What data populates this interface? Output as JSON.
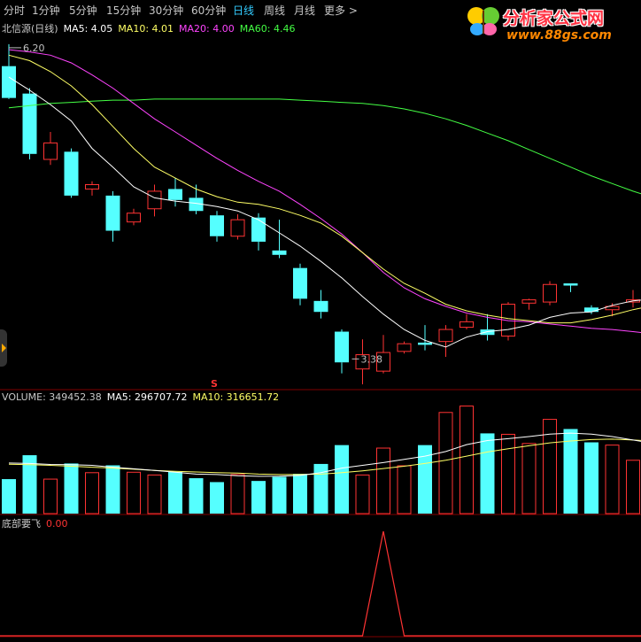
{
  "tabs": [
    {
      "label": "分时"
    },
    {
      "label": "1分钟"
    },
    {
      "label": "5分钟"
    },
    {
      "label": "15分钟"
    },
    {
      "label": "30分钟"
    },
    {
      "label": "60分钟"
    },
    {
      "label": "日线",
      "active": true
    },
    {
      "label": "周线"
    },
    {
      "label": "月线"
    },
    {
      "label": "更多 >"
    }
  ],
  "logo": {
    "title": "分析家公式网",
    "url": "www.88gs.com"
  },
  "price_legend": {
    "name": "北信源(日线)",
    "ma5": "MA5: 4.05",
    "ma10": "MA10: 4.01",
    "ma20": "MA20: 4.00",
    "ma60": "MA60: 4.46"
  },
  "volume_legend": {
    "vol": "VOLUME: 349452.38",
    "ma5": "MA5: 296707.72",
    "ma10": "MA10: 316651.72"
  },
  "indicator_legend": {
    "name": "底部要飞",
    "value": "0.00"
  },
  "signal_marker": "S",
  "high_label": "6.20",
  "low_label": "3.38",
  "colors": {
    "up": "#ff3333",
    "down": "#55ffff",
    "ma5": "#ffffff",
    "ma10": "#ffff66",
    "ma20": "#ff44ff",
    "ma60": "#44ff44",
    "grid": "#800000"
  },
  "chart_data": [
    {
      "type": "candlestick",
      "title": "北信源(日线)",
      "ohlc": [
        [
          6.0,
          6.2,
          5.7,
          5.71
        ],
        [
          5.75,
          5.8,
          5.15,
          5.2
        ],
        [
          5.15,
          5.4,
          5.1,
          5.3
        ],
        [
          5.22,
          5.25,
          4.8,
          4.82
        ],
        [
          4.88,
          4.95,
          4.82,
          4.92
        ],
        [
          4.82,
          4.86,
          4.4,
          4.5
        ],
        [
          4.58,
          4.7,
          4.55,
          4.66
        ],
        [
          4.7,
          4.92,
          4.63,
          4.86
        ],
        [
          4.88,
          4.98,
          4.72,
          4.78
        ],
        [
          4.8,
          4.92,
          4.65,
          4.68
        ],
        [
          4.64,
          4.68,
          4.4,
          4.45
        ],
        [
          4.45,
          4.65,
          4.42,
          4.6
        ],
        [
          4.62,
          4.66,
          4.32,
          4.4
        ],
        [
          4.32,
          4.6,
          4.25,
          4.28
        ],
        [
          4.16,
          4.2,
          3.82,
          3.88
        ],
        [
          3.86,
          3.96,
          3.7,
          3.76
        ],
        [
          3.58,
          3.6,
          3.2,
          3.3
        ],
        [
          3.24,
          3.51,
          3.1,
          3.37
        ],
        [
          3.22,
          3.55,
          3.2,
          3.39
        ],
        [
          3.4,
          3.49,
          3.38,
          3.47
        ],
        [
          3.48,
          3.64,
          3.41,
          3.46
        ],
        [
          3.49,
          3.64,
          3.35,
          3.6
        ],
        [
          3.62,
          3.74,
          3.6,
          3.67
        ],
        [
          3.6,
          3.74,
          3.5,
          3.55
        ],
        [
          3.54,
          3.85,
          3.5,
          3.83
        ],
        [
          3.84,
          3.88,
          3.78,
          3.87
        ],
        [
          3.85,
          4.04,
          3.82,
          4.01
        ],
        [
          4.02,
          4.02,
          3.94,
          4.0
        ],
        [
          3.8,
          3.82,
          3.74,
          3.76
        ],
        [
          3.78,
          3.84,
          3.72,
          3.81
        ],
        [
          3.85,
          3.96,
          3.8,
          3.87
        ],
        [
          3.85,
          3.88,
          3.73,
          3.8
        ]
      ],
      "ma5": [
        5.9,
        5.78,
        5.65,
        5.5,
        5.25,
        5.08,
        4.9,
        4.8,
        4.77,
        4.75,
        4.72,
        4.68,
        4.6,
        4.48,
        4.36,
        4.22,
        4.07,
        3.9,
        3.74,
        3.6,
        3.5,
        3.44,
        3.53,
        3.58,
        3.6,
        3.64,
        3.71,
        3.75,
        3.76,
        3.82,
        3.86,
        3.88
      ],
      "ma10": [
        6.1,
        6.05,
        5.95,
        5.82,
        5.65,
        5.45,
        5.25,
        5.08,
        4.98,
        4.88,
        4.81,
        4.76,
        4.74,
        4.7,
        4.64,
        4.57,
        4.45,
        4.3,
        4.15,
        4.02,
        3.93,
        3.83,
        3.77,
        3.73,
        3.7,
        3.68,
        3.66,
        3.66,
        3.69,
        3.73,
        3.78,
        3.82
      ],
      "ma20": [
        6.15,
        6.13,
        6.1,
        6.03,
        5.92,
        5.8,
        5.66,
        5.52,
        5.4,
        5.28,
        5.16,
        5.05,
        4.95,
        4.86,
        4.74,
        4.61,
        4.47,
        4.3,
        4.12,
        3.98,
        3.88,
        3.81,
        3.75,
        3.71,
        3.68,
        3.67,
        3.65,
        3.63,
        3.61,
        3.6,
        3.58,
        3.56
      ],
      "ma60": [
        5.62,
        5.64,
        5.66,
        5.67,
        5.68,
        5.69,
        5.69,
        5.7,
        5.7,
        5.7,
        5.7,
        5.7,
        5.7,
        5.7,
        5.69,
        5.68,
        5.67,
        5.66,
        5.64,
        5.61,
        5.57,
        5.52,
        5.46,
        5.39,
        5.32,
        5.24,
        5.16,
        5.08,
        5.0,
        4.93,
        4.86,
        4.8
      ],
      "high": {
        "index": 0,
        "value": 6.2
      },
      "low": {
        "index": 17,
        "value": 3.38
      },
      "ylim": [
        3.1,
        6.28
      ]
    },
    {
      "type": "bar",
      "title": "VOLUME",
      "values": [
        150000,
        254000,
        150000,
        218000,
        178000,
        210000,
        180000,
        168000,
        182000,
        154000,
        137000,
        170000,
        142000,
        160000,
        173000,
        216000,
        298000,
        168000,
        285000,
        208000,
        298000,
        440000,
        468000,
        349000,
        345000,
        305000,
        410000,
        368000,
        310000,
        298000,
        232000,
        182000
      ],
      "ma5": [
        220000,
        218000,
        214000,
        213000,
        210000,
        202000,
        195000,
        188000,
        180000,
        172000,
        170000,
        165000,
        162000,
        163000,
        166000,
        178000,
        198000,
        210000,
        222000,
        236000,
        250000,
        270000,
        300000,
        318000,
        326000,
        335000,
        346000,
        350000,
        346000,
        335000,
        320000,
        305000
      ],
      "ma10": [
        215000,
        213000,
        210000,
        206000,
        202000,
        198000,
        193000,
        188000,
        184000,
        181000,
        178000,
        176000,
        172000,
        170000,
        170000,
        172000,
        178000,
        186000,
        196000,
        206000,
        218000,
        232000,
        250000,
        268000,
        282000,
        295000,
        308000,
        316000,
        322000,
        324000,
        320000,
        316000
      ],
      "ylim": [
        0,
        470000
      ]
    },
    {
      "type": "line",
      "title": "底部要飞",
      "values": [
        0,
        0,
        0,
        0,
        0,
        0,
        0,
        0,
        0,
        0,
        0,
        0,
        0,
        0,
        0,
        0,
        0,
        0,
        1,
        0,
        0,
        0,
        0,
        0,
        0,
        0,
        0,
        0,
        0,
        0,
        0,
        0
      ],
      "ylim": [
        0,
        1
      ]
    }
  ]
}
